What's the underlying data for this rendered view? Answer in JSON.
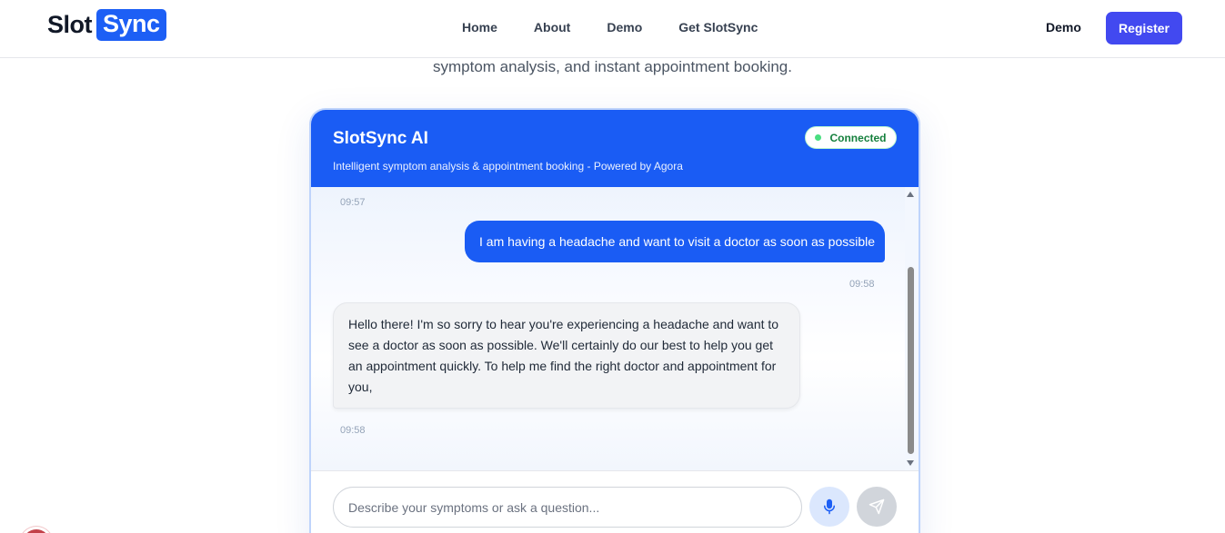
{
  "brand": {
    "part1": "Slot",
    "part2": "Sync",
    "accent_color": "#1d5ff5"
  },
  "nav": {
    "links": [
      "Home",
      "About",
      "Demo",
      "Get SlotSync"
    ],
    "right_link": "Demo",
    "register_label": "Register",
    "register_color": "#4249f0"
  },
  "hero": {
    "subtitle": "symptom analysis, and instant appointment booking."
  },
  "chat": {
    "title": "SlotSync AI",
    "subtitle": "Intelligent symptom analysis & appointment booking - Powered by Agora",
    "status": "Connected",
    "status_color": "#15803d",
    "header_color": "#1a5cf4",
    "messages": [
      {
        "sender": "ai",
        "timestamp": "09:57"
      },
      {
        "sender": "user",
        "text": "I am having a headache and want to visit a doctor as soon as possible",
        "timestamp": "09:58"
      },
      {
        "sender": "ai",
        "text": "Hello there! I'm so sorry to hear you're experiencing a headache and want to see a doctor as soon as possible. We'll certainly do our best to help you get an appointment quickly. To help me find the right doctor and appointment for you,",
        "timestamp": "09:58"
      }
    ],
    "input_placeholder": "Describe your symptoms or ask a question...",
    "input_value": "",
    "mic_icon": "microphone-icon",
    "send_icon": "send-icon"
  }
}
